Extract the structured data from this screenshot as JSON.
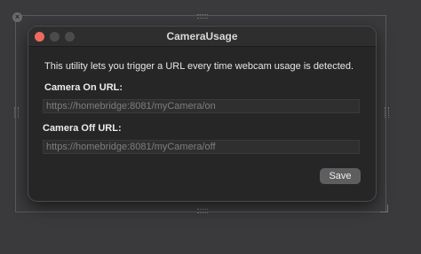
{
  "window": {
    "title": "CameraUsage"
  },
  "main": {
    "description": "This utility lets you trigger a URL every time webcam usage is detected.",
    "camera_on": {
      "label": "Camera On URL:",
      "placeholder": "https://homebridge:8081/myCamera/on",
      "value": ""
    },
    "camera_off": {
      "label": "Camera Off URL:",
      "placeholder": "https://homebridge:8081/myCamera/off",
      "value": ""
    },
    "save_label": "Save"
  },
  "colors": {
    "close": "#ed6a5e",
    "window_bg": "#262626",
    "button_bg": "#5e5e60"
  },
  "icons": {
    "outer_close": "close-icon"
  }
}
